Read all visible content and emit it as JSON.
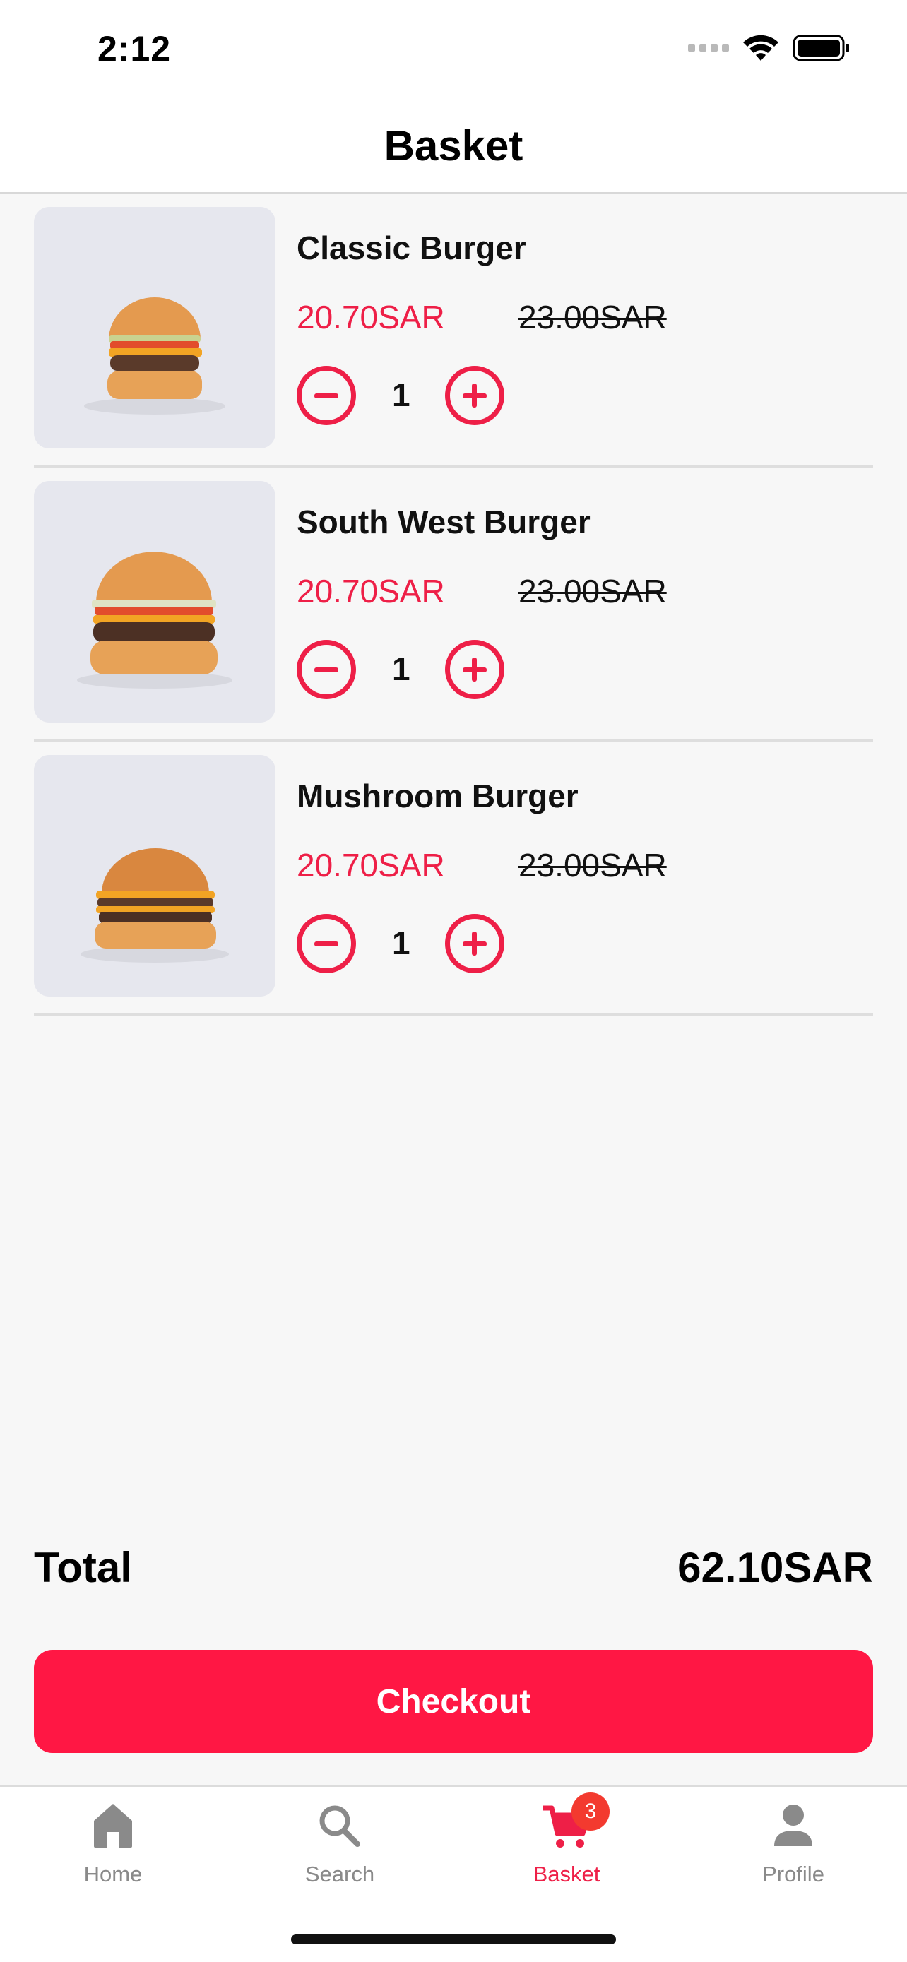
{
  "status_bar": {
    "time": "2:12"
  },
  "header": {
    "title": "Basket"
  },
  "basket": {
    "items": [
      {
        "name": "Classic Burger",
        "price": "20.70SAR",
        "old_price": "23.00SAR",
        "quantity": "1"
      },
      {
        "name": "South West Burger",
        "price": "20.70SAR",
        "old_price": "23.00SAR",
        "quantity": "1"
      },
      {
        "name": "Mushroom Burger",
        "price": "20.70SAR",
        "old_price": "23.00SAR",
        "quantity": "1"
      }
    ]
  },
  "summary": {
    "total_label": "Total",
    "total_value": "62.10SAR"
  },
  "checkout": {
    "label": "Checkout"
  },
  "tabbar": {
    "tabs": [
      {
        "label": "Home",
        "icon": "home-icon"
      },
      {
        "label": "Search",
        "icon": "search-icon"
      },
      {
        "label": "Basket",
        "icon": "cart-icon",
        "badge": "3",
        "active": true
      },
      {
        "label": "Profile",
        "icon": "profile-icon"
      }
    ]
  },
  "colors": {
    "accent": "#ee1f47",
    "button": "#ff1744",
    "badge": "#f33a2f"
  }
}
